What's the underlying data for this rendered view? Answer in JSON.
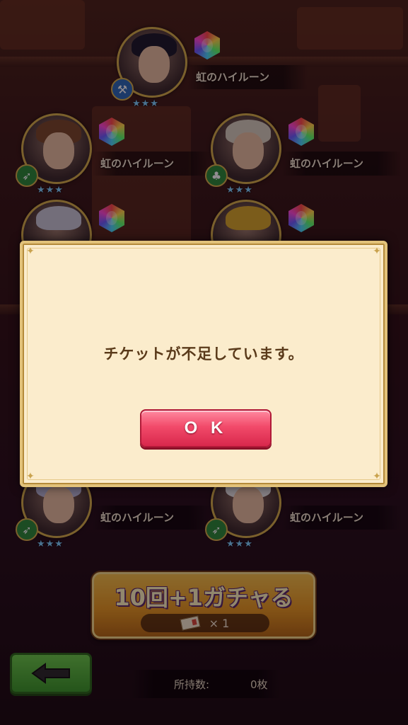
{
  "gacha_results": [
    {
      "name": "虹のハイルーン",
      "stars": "★★★",
      "attr_color": "#2a6ab8",
      "attr_icon": "hammer-icon"
    },
    {
      "name": "虹のハイルーン",
      "stars": "★★★",
      "attr_color": "#2a8a3a",
      "attr_icon": "spear-icon"
    },
    {
      "name": "虹のハイルーン",
      "stars": "★★★",
      "attr_color": "#2a8a3a",
      "attr_icon": "tree-icon"
    },
    {
      "name": "虹のハイルーン",
      "stars": "★★★",
      "attr_color": "#2a8a3a",
      "attr_icon": "spear-icon"
    },
    {
      "name": "虹のハイルーン",
      "stars": "★★★",
      "attr_color": "#2a8a3a",
      "attr_icon": "spear-icon"
    }
  ],
  "dialog": {
    "message": "チケットが不足しています。",
    "ok_label": "O K"
  },
  "gacha_button": {
    "label": "10回+1ガチャる",
    "cost": "× 1"
  },
  "footer": {
    "owned_label": "所持数:",
    "owned_value": "0枚"
  },
  "colors": {
    "ok_button": "#f24a6a",
    "back_button": "#3a9a2a",
    "dialog_bg": "#fbeccc",
    "gacha_button": "#e89a22"
  }
}
